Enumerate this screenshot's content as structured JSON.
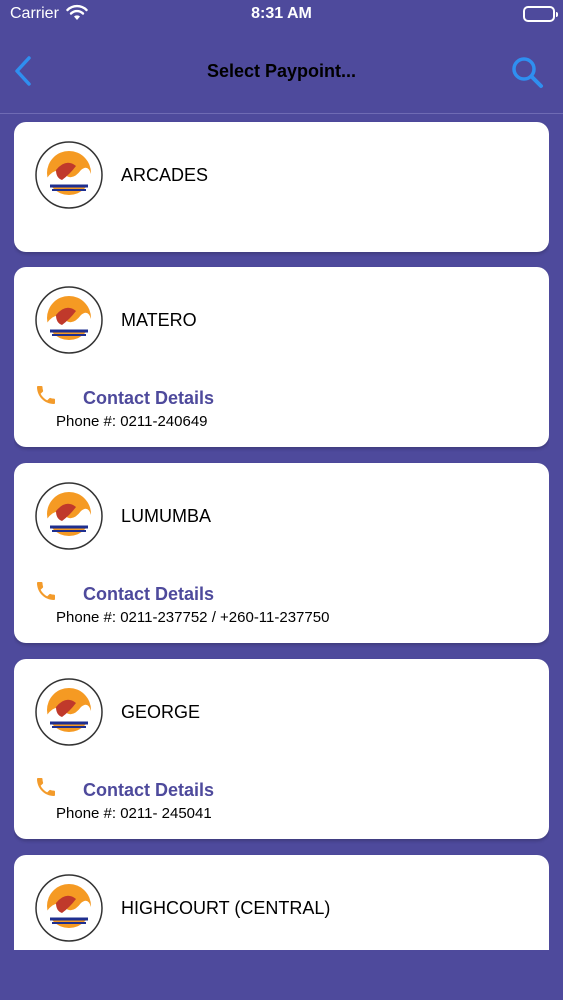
{
  "status_bar": {
    "carrier": "Carrier",
    "time": "8:31 AM"
  },
  "nav": {
    "title": "Select Paypoint..."
  },
  "contact_label": "Contact Details",
  "paypoints": [
    {
      "name": "ARCADES",
      "phone": ""
    },
    {
      "name": "MATERO",
      "phone": "Phone #: 0211-240649"
    },
    {
      "name": "LUMUMBA",
      "phone": "Phone #: 0211-237752 / +260-11-237750"
    },
    {
      "name": "GEORGE",
      "phone": "Phone #: 0211- 245041"
    },
    {
      "name": "HIGHCOURT (CENTRAL)",
      "phone": ""
    }
  ],
  "colors": {
    "background": "#4e4a9c",
    "accent_blue": "#2f8ff0",
    "phone_orange": "#f39b2b",
    "contact_title": "#4e4a9c"
  }
}
